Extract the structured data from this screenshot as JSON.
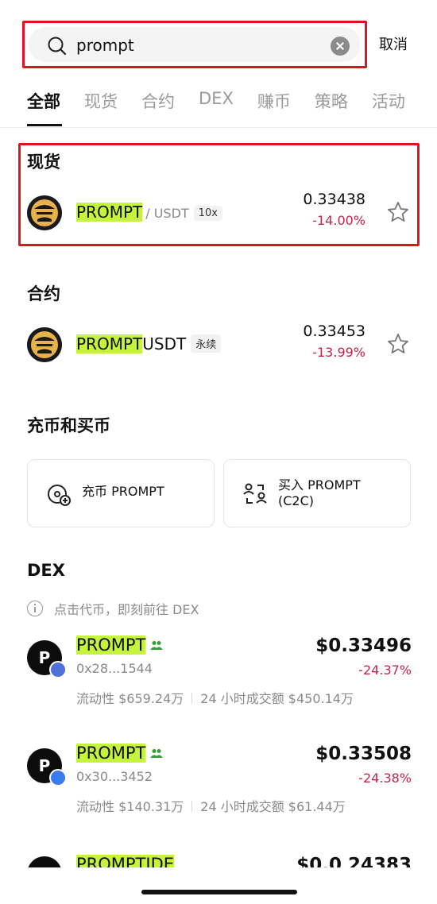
{
  "search": {
    "query": "prompt",
    "cancel_label": "取消"
  },
  "tabs": [
    {
      "label": "全部",
      "active": true
    },
    {
      "label": "现货",
      "active": false
    },
    {
      "label": "合约",
      "active": false
    },
    {
      "label": "DEX",
      "active": false
    },
    {
      "label": "赚币",
      "active": false
    },
    {
      "label": "策略",
      "active": false
    },
    {
      "label": "活动",
      "active": false
    }
  ],
  "spot": {
    "title": "现货",
    "item": {
      "base": "PROMPT",
      "quote": "/ USDT",
      "tag": "10x",
      "price": "0.33438",
      "change": "-14.00%"
    }
  },
  "futures": {
    "title": "合约",
    "item": {
      "base": "PROMPT",
      "quote": "USDT",
      "tag": "永续",
      "price": "0.33453",
      "change": "-13.99%"
    }
  },
  "deposit": {
    "title": "充币和买币",
    "deposit_label": "充币 PROMPT",
    "buy_label_line1": "买入 PROMPT",
    "buy_label_line2": "(C2C)"
  },
  "dex": {
    "title": "DEX",
    "note": "点击代币，即刻前往 DEX",
    "items": [
      {
        "logo": "P",
        "name": "PROMPT",
        "address": "0x28...1544",
        "liquidity": "流动性 $659.24万",
        "volume": "24 小时成交额 $450.14万",
        "price": "$0.33496",
        "change": "-24.37%",
        "chain": "ethereum"
      },
      {
        "logo": "P",
        "name": "PROMPT",
        "address": "0x30...3452",
        "liquidity": "流动性 $140.31万",
        "volume": "24 小时成交额 $61.44万",
        "price": "$0.33508",
        "change": "-24.38%",
        "chain": "base"
      }
    ],
    "partial": {
      "name": "PROMPTIDE",
      "price": "$0.0 24383"
    }
  },
  "colors": {
    "highlight": "#c6f33c",
    "negative": "#c0284a",
    "annotation_border": "#e0141e"
  }
}
